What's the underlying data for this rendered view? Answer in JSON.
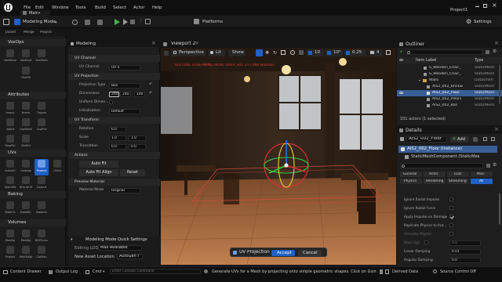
{
  "titlebar": {
    "menus": [
      "File",
      "Edit",
      "Window",
      "Tools",
      "Build",
      "Select",
      "Actor",
      "Help"
    ],
    "level_tab": "Main•",
    "project": "Project1"
  },
  "toolbar": {
    "mode": "Modeling Mode",
    "platforms": "Platforms",
    "settings": "Settings"
  },
  "palette": {
    "tabs": [
      "Jacket",
      "Merge",
      "Project"
    ],
    "categories": [
      {
        "name": "VoxOps",
        "tools": [
          "VoxWrap",
          "VoxBlnd",
          "VoxMrph",
          "VoxFill"
        ]
      },
      {
        "name": "Attributes",
        "tools": [
          "Inspct",
          "Nrmls",
          "Tngnts",
          "AttEd",
          "GrpMesh",
          "GrpPnt",
          "MapPnt",
          "MatEd"
        ]
      },
      {
        "name": "UVs",
        "tools": [
          "AutoUV",
          "Unwrap",
          "Project",
          "UVEd",
          "SeamEd",
          "XFormUV",
          "Layout"
        ]
      },
      {
        "name": "Baking",
        "tools": [
          "BakeTx",
          "BakeRC",
          "BakeVx"
        ]
      },
      {
        "name": "Volumes",
        "tools": [
          "MshVol",
          "MshSpl",
          "BSPConv",
          "Project",
          "MshToSpl",
          "ColMsh"
        ]
      }
    ]
  },
  "modeling": {
    "title": "Modeling",
    "sections": {
      "uv_channel": "UV Channel",
      "uv_projection": "UV Projection",
      "uv_transform": "UV Transform",
      "actions": "Actions",
      "preview": "Preview Material"
    },
    "rows": {
      "uv_channel": {
        "label": "UV Channel",
        "value": "UV 0"
      },
      "projection_type": {
        "label": "Projection Type",
        "value": "Box"
      },
      "dimensions": {
        "label": "Dimensions",
        "x": "200.0",
        "y": "200.0",
        "z": "100"
      },
      "uniform": {
        "label": "Uniform Dimen..."
      },
      "initialization": {
        "label": "Initialization",
        "value": "Default"
      },
      "rotation": {
        "label": "Rotation",
        "value": "0.0"
      },
      "scale": {
        "label": "Scale",
        "x": "1.0",
        "y": "1.0"
      },
      "translation": {
        "label": "Translation",
        "x": "0.0",
        "y": "0.0"
      },
      "material_mode": {
        "label": "Material Mode",
        "value": "Original"
      }
    },
    "actions": {
      "auto_fit": "Auto Fit",
      "auto_fit_align": "Auto Fit Align",
      "reset": "Reset"
    },
    "quick_settings": {
      "title": "Modeling Mode Quick Settings",
      "editing_lod_label": "Editing LOD",
      "editing_lod_value": "Max Available",
      "new_asset_label": "New Asset Location",
      "new_asset_value": "AutoGen f"
    }
  },
  "viewport": {
    "title": "Viewport 2",
    "view": "Perspective",
    "lit": "Lit",
    "show": "Show",
    "warning": "TEXTURE STREAMING POOL OVER 301.377 MiB BUDGET",
    "snap_values": [
      "10",
      "10°",
      "0.25",
      "4"
    ],
    "uv_projection": "UV Projection",
    "accept": "Accept",
    "cancel": "Cancel"
  },
  "outliner": {
    "title": "Outliner",
    "search_placeholder": "Search",
    "col_item": "Item Label",
    "col_type": "Type",
    "rows": [
      {
        "label": "S_Wooden_Chair_",
        "type": "StaticMesh"
      },
      {
        "label": "S_Wooden_Chair_",
        "type": "StaticMesh"
      },
      {
        "label": "Walls",
        "type": "Datasmith"
      },
      {
        "label": "AIS2_002_Brickw",
        "type": "StaticMesh"
      },
      {
        "label": "AIS2_002_Floor",
        "type": "StaticMesh"
      },
      {
        "label": "AIS2_002_Pillars",
        "type": "StaticMesh"
      },
      {
        "label": "AIS2_002_Bas",
        "type": "StaticMesh"
      }
    ],
    "count": "331 actors (1 selected)"
  },
  "details": {
    "title": "Details",
    "actor_name": "AIS2_002_Floor",
    "add": "Add",
    "instance": "AIS2_002_Floor (Instance)",
    "component": "StaticMeshComponent (StaticMes",
    "search_placeholder": "Search",
    "filter_tabs": [
      "General",
      "Actor",
      "LOD",
      "Misc",
      "Physics",
      "Rendering",
      "Streaming",
      "All"
    ],
    "props": [
      {
        "label": "Ignore Radial Impulse",
        "checked": false
      },
      {
        "label": "Ignore Radial Force",
        "checked": false
      },
      {
        "label": "Apply Impulse on Damage",
        "checked": true
      },
      {
        "label": "Replicate Physics to Aut...",
        "checked": false
      },
      {
        "label": "Simulate Physics",
        "checked": false
      },
      {
        "label": "Mass (kg)",
        "value": "0.0"
      },
      {
        "label": "Linear Damping",
        "value": "0.01"
      },
      {
        "label": "Angular Damping",
        "value": "0.0"
      }
    ]
  },
  "statusbar": {
    "content_drawer": "Content Drawer",
    "output_log": "Output Log",
    "cmd": "Cmd",
    "console_placeholder": "Enter Console Command",
    "hint": "Generate UVs for a Mesh by projecting onto simple geometric shapes. Click on Gizmo to reposition",
    "derived": "Derived Data",
    "source_control": "Source Control Off"
  }
}
